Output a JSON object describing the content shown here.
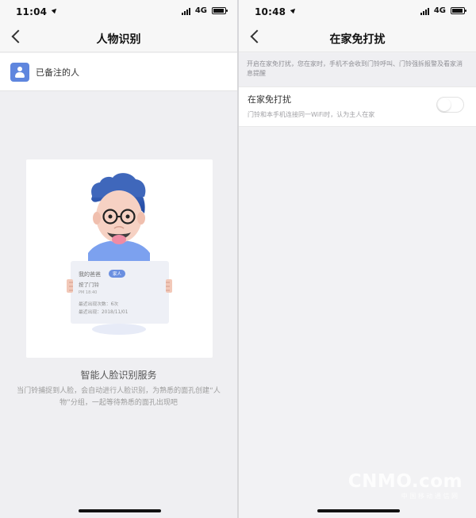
{
  "left_screen": {
    "status_time": "11:04",
    "network": "4G",
    "title": "人物识别",
    "row_label": "已备注的人",
    "illustration": {
      "person_name": "我的爸爸",
      "tag": "家人",
      "event": "按了门铃",
      "time": "PM 18:40",
      "count_label": "最近出现次数：6次",
      "recent_label": "最近出现：2018/11/01"
    },
    "service_title": "智能人脸识别服务",
    "service_desc": "当门铃捕捉到人脸，会自动进行人脸识别，为熟悉的面孔创建“人物”分组，一起等待熟悉的面孔出现吧"
  },
  "right_screen": {
    "status_time": "10:48",
    "network": "4G",
    "title": "在家免打扰",
    "note": "开启在家免打扰，您在家时，手机不会收到门铃呼叫、门铃强拆报警及看家消息提醒",
    "setting_title": "在家免打扰",
    "setting_desc": "门铃和本手机连接同一WiFi时，认为主人在家",
    "toggle_state": "off"
  },
  "watermark": {
    "main": "CNMO.com",
    "sub": "中 国 移 动 通 信 网"
  },
  "icons": {
    "back": "chevron-left-icon",
    "location": "location-arrow-icon",
    "signal": "signal-icon",
    "battery": "battery-icon",
    "person": "person-icon"
  },
  "colors": {
    "accent": "#5f86de",
    "background": "#efeff2",
    "text_primary": "#333333",
    "text_secondary": "#9c9c9c"
  }
}
